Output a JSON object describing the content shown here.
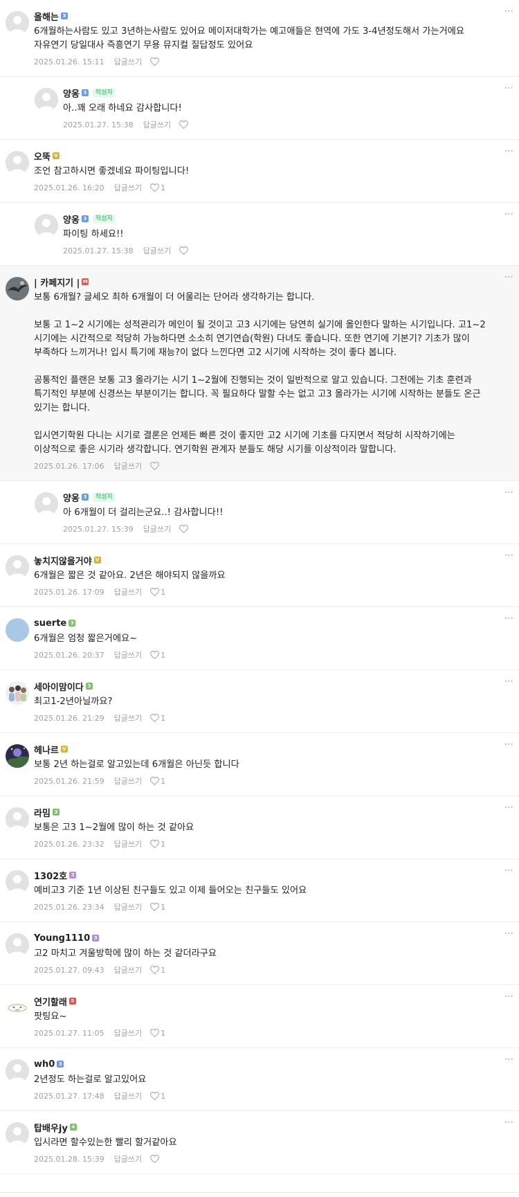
{
  "comments": [
    {
      "nick": "올해는",
      "level": "3",
      "level_color": "#6a9be6",
      "avatar": "default",
      "author": false,
      "reply": false,
      "highlight": false,
      "text": "6개월하는사람도 있고 3년하는사람도 있어요 메이저대학가는 예고애들은 현역에 가도 3-4년정도해서 가는거에요 자유연기 당일대사 즉흥연기 무용 뮤지컬 질답정도 있어요",
      "date": "2025.01.26. 15:11",
      "likes": ""
    },
    {
      "nick": "양옹",
      "level": "3",
      "level_color": "#6a9be6",
      "avatar": "default",
      "author": true,
      "reply": true,
      "highlight": false,
      "text": "아..꽤 오래 하네요 감사합니다!",
      "date": "2025.01.27. 15:38",
      "likes": ""
    },
    {
      "nick": "오뚝",
      "level": "V",
      "level_color": "#d9b437",
      "avatar": "default",
      "author": false,
      "reply": false,
      "highlight": false,
      "text": "조언 참고하시면 좋겠네요 파이팅입니다!",
      "date": "2025.01.26. 16:20",
      "likes": "1"
    },
    {
      "nick": "양옹",
      "level": "3",
      "level_color": "#6a9be6",
      "avatar": "default",
      "author": true,
      "reply": true,
      "highlight": false,
      "text": "파이팅 하세요!!",
      "date": "2025.01.27. 15:38",
      "likes": ""
    },
    {
      "nick": "| 카페지기 |",
      "level": "M",
      "level_color": "#e2574c",
      "avatar": "bird",
      "author": false,
      "reply": false,
      "highlight": true,
      "text": "보통 6개월? 글세오 최하 6개월이 더 어울리는 단어라 생각하기는 합니다.\n\n보통 고 1~2 시기에는 성적관리가 메인이 될 것이고 고3 시기에는 당연히 실기에 올인한다 말하는 시기입니다. 고1~2 시기에는 시간적으로 적당히 가능하다면 소소히 연기연습(학원) 다녀도 좋습니다. 또한 연기에 기본기? 기초가 많이 부족하다 느끼거나! 입시 특기에 재능?이 없다 느낀다면 고2 시기에 시작하는 것이 좋다 봅니다.\n\n공통적인 플랜은 보통 고3 올라기는 시기 1~2월에 진행되는 것이 일반적으로 알고 있습니다. 그전에는 기초 훈련과 특기적인 부분에 신경쓰는 부분이기는 합니다. 꼭 필요하다 말할 수는 없고 고3 올라가는 시기에 시작하는 분들도 온근 있기는 합니다.\n\n입시연기학원 다니는 시기로 결론은 언제든 빠른 것이 좋지만 고2 시기에 기초를 다지면서 적당히 시작하기에는 이상적으로 좋은 시기라 생각합니다. 연기학원 관계자 분들도 해당 시기를 이상적이라 말합니다.",
      "date": "2025.01.26. 17:06",
      "likes": ""
    },
    {
      "nick": "양옹",
      "level": "3",
      "level_color": "#6a9be6",
      "avatar": "default",
      "author": true,
      "reply": true,
      "highlight": false,
      "text": "아 6개월이 더 걸리는군요..! 감사합니다!!",
      "date": "2025.01.27. 15:39",
      "likes": ""
    },
    {
      "nick": "놓치지않을거야",
      "level": "V",
      "level_color": "#d9b437",
      "avatar": "default",
      "author": false,
      "reply": false,
      "highlight": false,
      "text": "6개월은 짧은 것 같아요. 2년은 해야되지 않을까요",
      "date": "2025.01.26. 17:09",
      "likes": "1"
    },
    {
      "nick": "suerte",
      "level": "3",
      "level_color": "#7cc46a",
      "avatar": "blue",
      "author": false,
      "reply": false,
      "highlight": false,
      "text": "6개월은 엄청 짧은거에요~",
      "date": "2025.01.26. 20:37",
      "likes": "1"
    },
    {
      "nick": "세아이맘이다",
      "level": "3",
      "level_color": "#7cc46a",
      "avatar": "photo-family",
      "author": false,
      "reply": false,
      "highlight": false,
      "text": "최고1-2년아닐까요?",
      "date": "2025.01.26. 21:29",
      "likes": "1"
    },
    {
      "nick": "헤나르",
      "level": "V",
      "level_color": "#d9b437",
      "avatar": "photo-night",
      "author": false,
      "reply": false,
      "highlight": false,
      "text": "보통 2년 하는걸로 알고있는데 6개월은 아닌듯 합니다",
      "date": "2025.01.26. 21:59",
      "likes": "1"
    },
    {
      "nick": "라밈",
      "level": "3",
      "level_color": "#7cc46a",
      "avatar": "default",
      "author": false,
      "reply": false,
      "highlight": false,
      "text": "보통은 고3 1~2월에 많이 하는 것 같아요",
      "date": "2025.01.26. 23:32",
      "likes": "1"
    },
    {
      "nick": "1302호",
      "level": "3",
      "level_color": "#b58be0",
      "avatar": "default",
      "author": false,
      "reply": false,
      "highlight": false,
      "text": "예비고3 기준 1년 이상된 친구들도 있고 이제 들어오는 친구들도 있어요",
      "date": "2025.01.26. 23:34",
      "likes": "1"
    },
    {
      "nick": "Young1110",
      "level": "3",
      "level_color": "#b58be0",
      "avatar": "default",
      "author": false,
      "reply": false,
      "highlight": false,
      "text": "고2 마치고 겨울방학에 많이 하는 것 같더라구요",
      "date": "2025.01.27. 09:43",
      "likes": "1"
    },
    {
      "nick": "연기할래",
      "level": "5",
      "level_color": "#e2574c",
      "avatar": "sketch",
      "author": false,
      "reply": false,
      "highlight": false,
      "text": "팟팅요~",
      "date": "2025.01.27. 11:05",
      "likes": "1"
    },
    {
      "nick": "wh0",
      "level": "3",
      "level_color": "#6a9be6",
      "avatar": "default",
      "author": false,
      "reply": false,
      "highlight": false,
      "text": "2년정도 하는걸로 알고있어요",
      "date": "2025.01.27. 17:48",
      "likes": "1"
    },
    {
      "nick": "탑배우jy",
      "level": "4",
      "level_color": "#7cc46a",
      "avatar": "default",
      "author": false,
      "reply": false,
      "highlight": false,
      "text": "입시라면 할수있는한 빨리 할거같아요",
      "date": "2025.01.28. 15:39",
      "likes": ""
    }
  ],
  "labels": {
    "reply": "답글쓰기",
    "author_badge": "작성자",
    "more": "⋯"
  },
  "icons": {
    "like": "heart-icon",
    "more": "more-icon",
    "default_avatar": "default-profile-icon"
  }
}
